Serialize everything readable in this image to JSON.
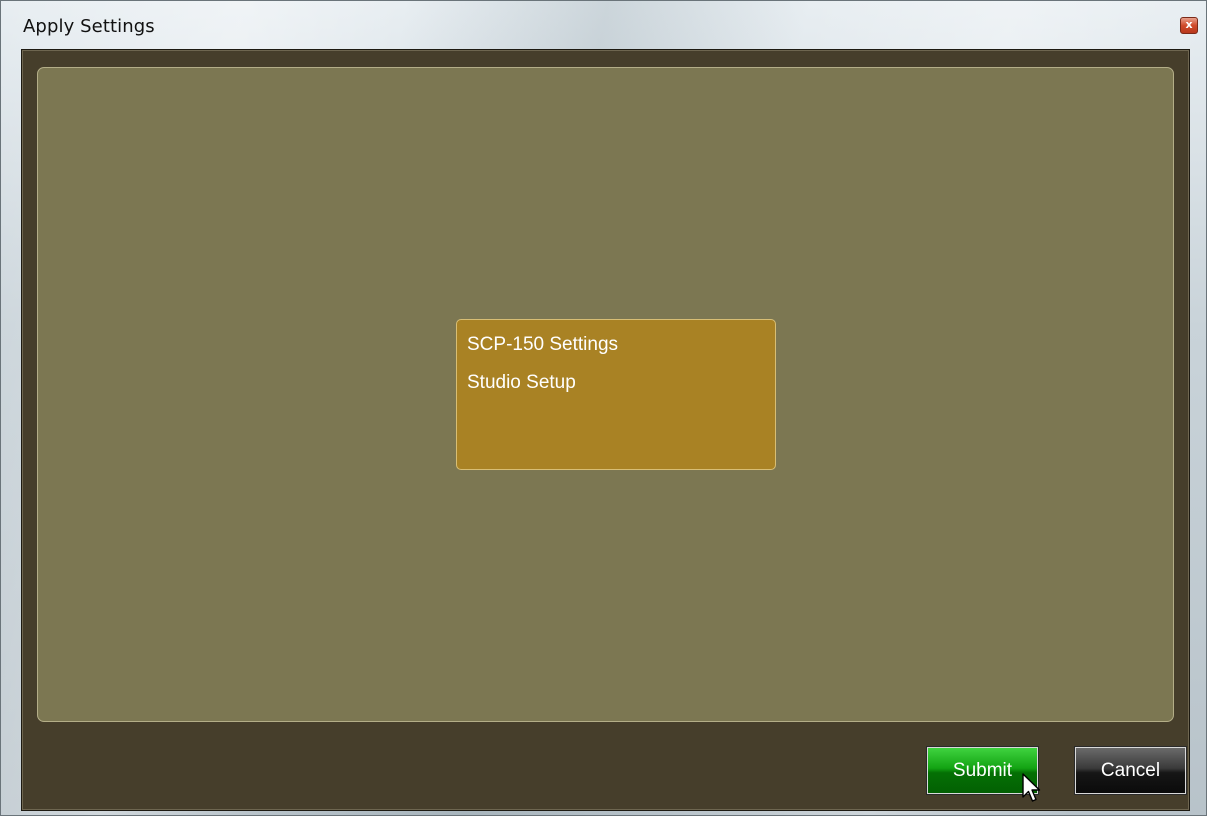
{
  "window": {
    "title": "Apply Settings",
    "close_glyph": "x",
    "close_icon": "close-icon"
  },
  "settings_card": {
    "lines": [
      "SCP-150 Settings",
      "Studio Setup"
    ]
  },
  "actions": {
    "submit_label": "Submit",
    "cancel_label": "Cancel"
  },
  "colors": {
    "client_bg": "#463e2b",
    "panel_bg": "#7c7752",
    "card_bg": "#a98224",
    "submit_green": "#13a313",
    "cancel_black": "#161616"
  },
  "pointer": {
    "icon": "mouse-pointer-icon"
  }
}
